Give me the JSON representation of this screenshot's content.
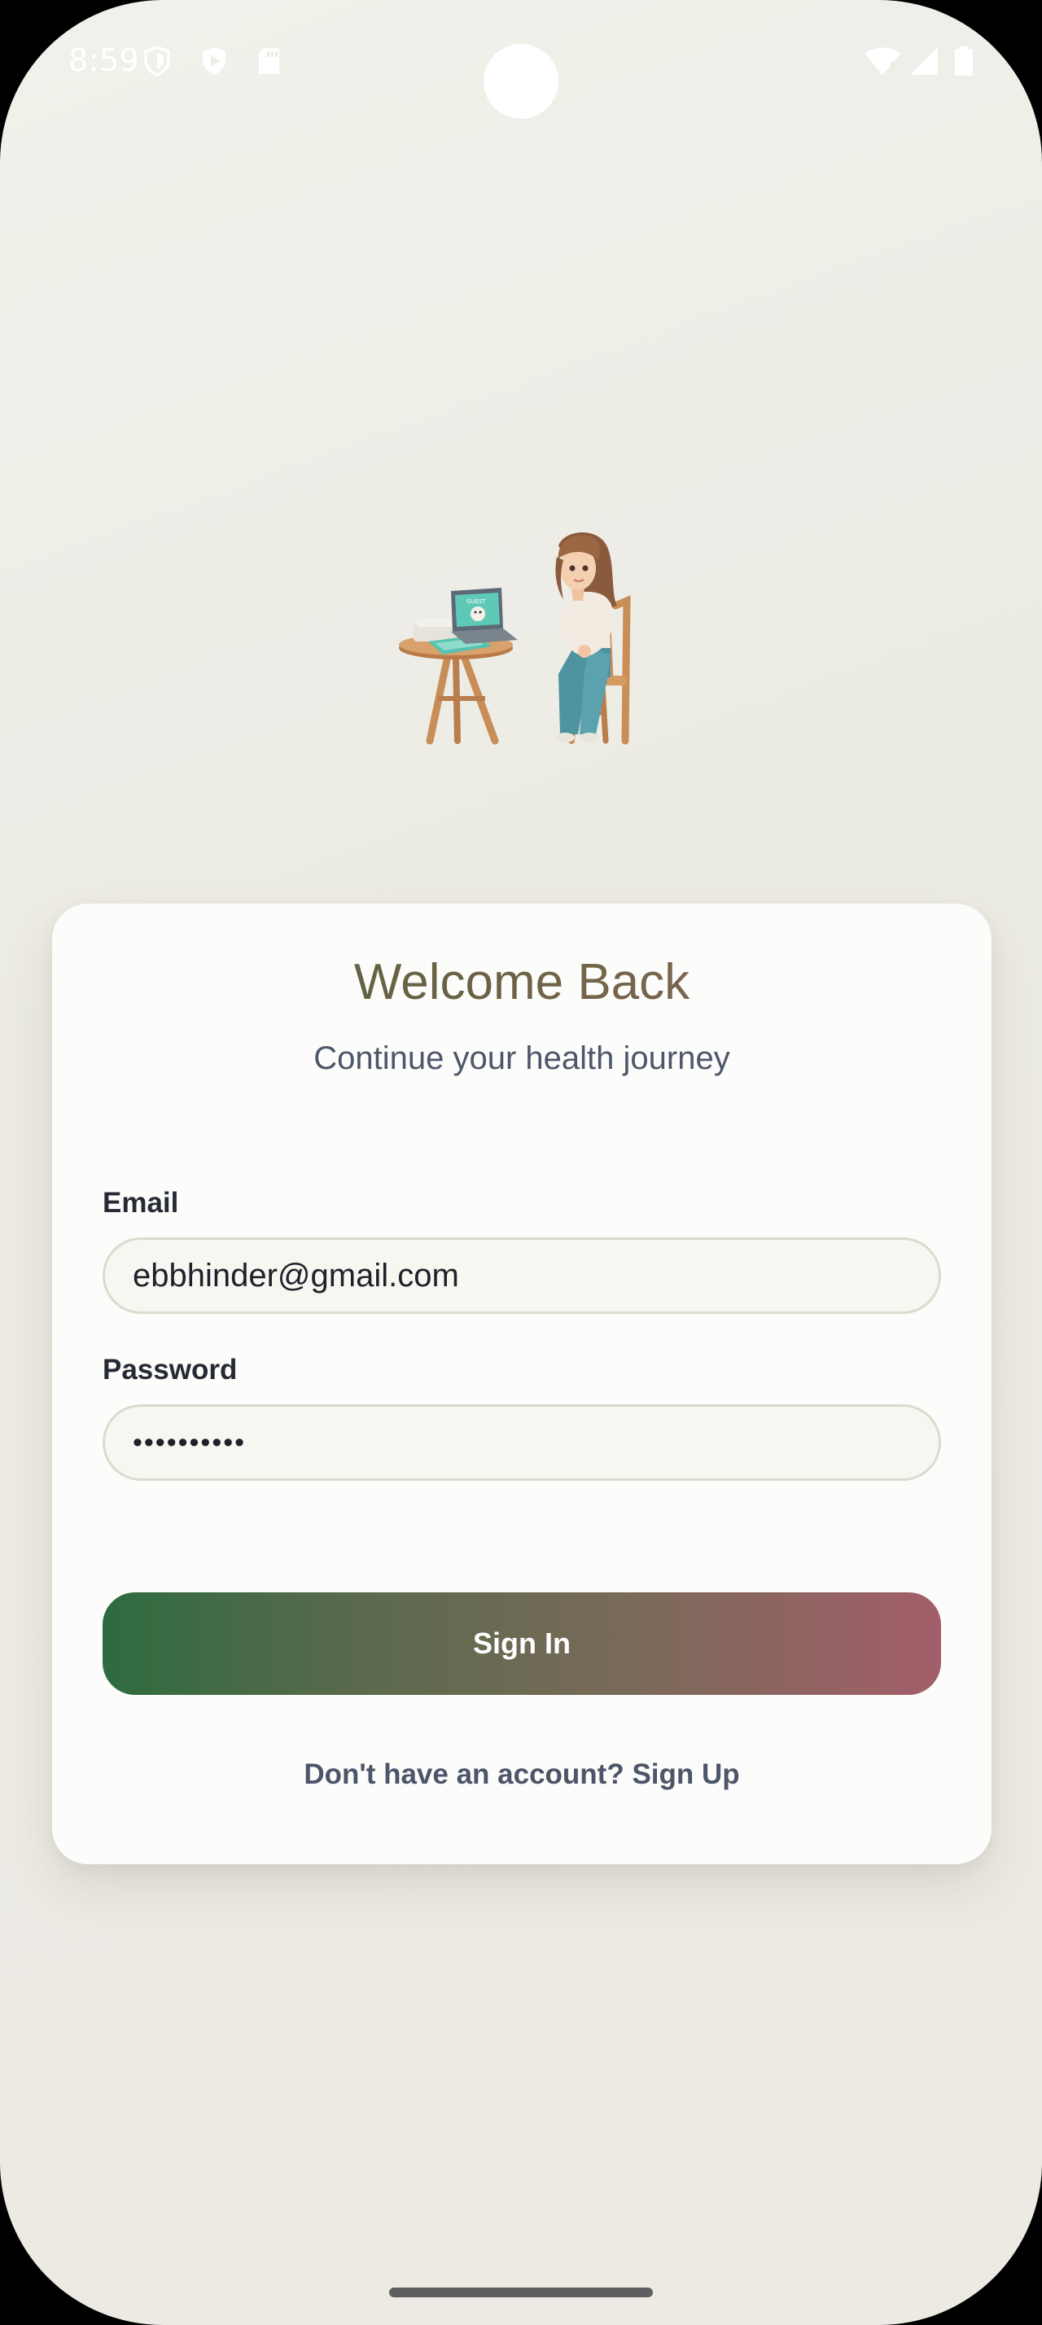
{
  "status_bar": {
    "time": "8:59",
    "left_icons": [
      "shield-icon",
      "play-protect-icon",
      "sd-card-icon"
    ],
    "right_icons": [
      "wifi-icon",
      "cell-signal-icon",
      "battery-icon"
    ]
  },
  "illustration": {
    "name": "woman-at-laptop-illustration",
    "screen_text": "GUEST"
  },
  "login": {
    "title": "Welcome Back",
    "subtitle": "Continue your health journey",
    "email_label": "Email",
    "email_value": "ebbhinder@gmail.com",
    "password_label": "Password",
    "password_value": "••••••••••",
    "signin_label": "Sign In",
    "signup_prompt": "Don't have an account? Sign Up"
  },
  "colors": {
    "background": "#edebe4",
    "card": "#fcfcfb",
    "button_gradient_start": "#2e6b3e",
    "button_gradient_end": "#a35e6a",
    "title_gradient_start": "#55653f",
    "title_gradient_end": "#8f6a5a",
    "subtitle_text": "#4e5669",
    "input_border": "#d9dccd"
  }
}
